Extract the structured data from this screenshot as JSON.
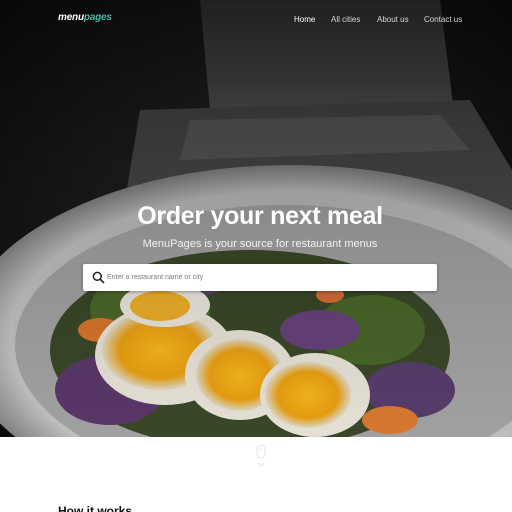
{
  "brand": {
    "logo_part1": "menu",
    "logo_part2": "pages",
    "accent": "#3fbfa8"
  },
  "nav": {
    "items": [
      {
        "label": "Home",
        "active": true
      },
      {
        "label": "All cities",
        "active": false
      },
      {
        "label": "About us",
        "active": false
      },
      {
        "label": "Contact us",
        "active": false
      }
    ]
  },
  "hero": {
    "title": "Order your next meal",
    "subtitle": "MenuPages is your source for restaurant menus"
  },
  "search": {
    "placeholder": "Enter a restaurant name or city",
    "value": "",
    "icon": "search-icon"
  },
  "scroll_hint": {
    "icon": "mouse-scroll-icon"
  },
  "how_it_works": {
    "title": "How it works"
  }
}
